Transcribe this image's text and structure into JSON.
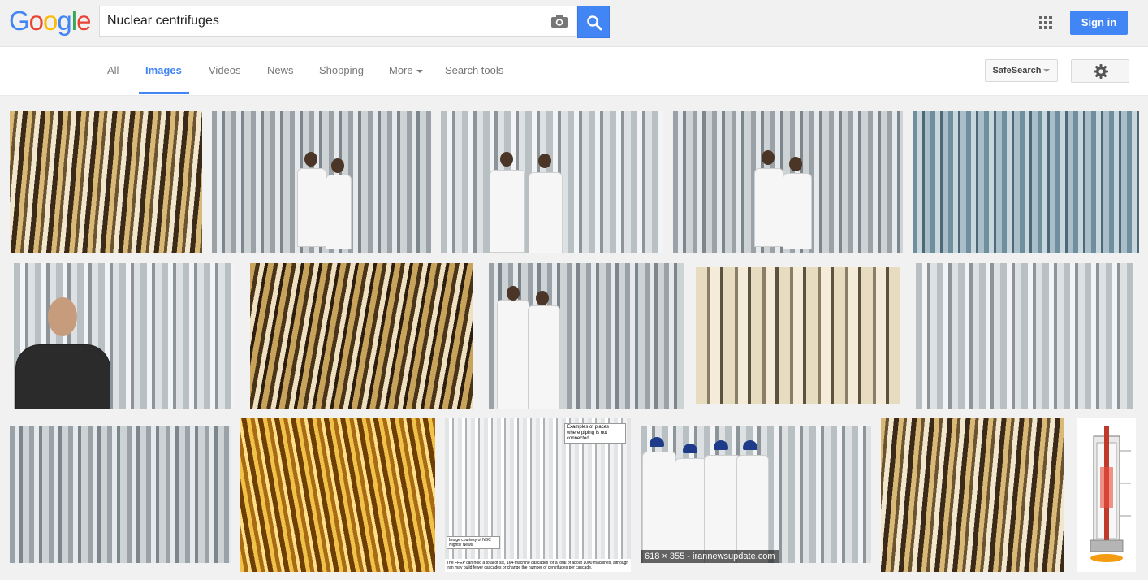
{
  "header": {
    "logo_text": "Google",
    "logo_colors": [
      "#4285f4",
      "#ea4335",
      "#fbbc05",
      "#4285f4",
      "#34a853",
      "#ea4335"
    ],
    "search_value": "Nuclear centrifuges",
    "camera_icon": "camera-icon",
    "search_icon": "magnifier-icon",
    "apps_icon": "apps-grid-icon",
    "signin_label": "Sign in"
  },
  "nav": {
    "tabs": [
      {
        "label": "All",
        "active": false
      },
      {
        "label": "Images",
        "active": true
      },
      {
        "label": "Videos",
        "active": false
      },
      {
        "label": "News",
        "active": false
      },
      {
        "label": "Shopping",
        "active": false
      },
      {
        "label": "More",
        "active": false
      },
      {
        "label": "Search tools",
        "active": false
      }
    ],
    "safesearch_label": "SafeSearch",
    "settings_icon": "gear-icon"
  },
  "results": {
    "hover_caption": "618 × 355 - irannewsupdate.com",
    "diagram_callout_top": "Examples of places where piping is not connected",
    "diagram_callout_credit": "Image courtesy of NBC Nightly News",
    "diagram_caption": "The FFEP can hold a total of six, 164-machine cascades for a total of about 1000 machines, although Iran may build fewer cascades or change the number of centrifuges per cascade."
  },
  "colors": {
    "accent": "#4285f4",
    "tab_text": "#777777",
    "background": "#f1f1f1"
  }
}
